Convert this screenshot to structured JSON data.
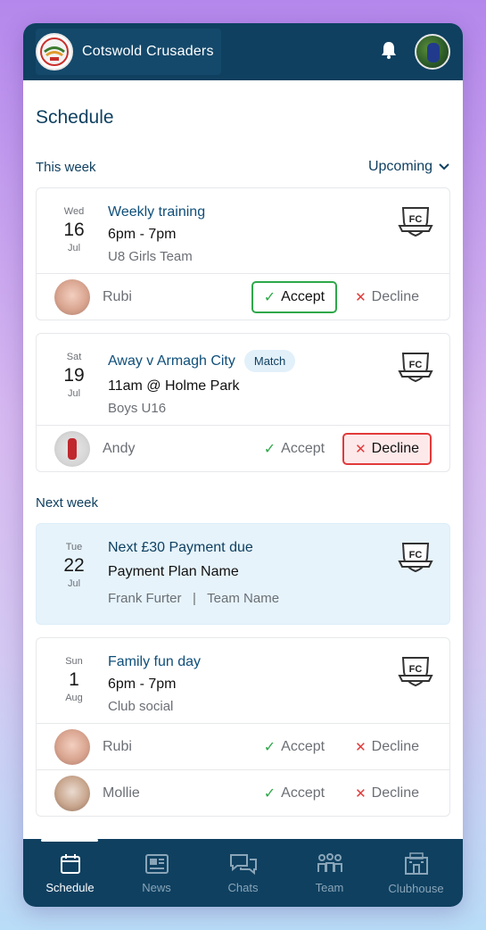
{
  "header": {
    "club_name": "Cotswold Crusaders",
    "bell_icon": "bell-icon",
    "profile_icon": "user-avatar"
  },
  "page": {
    "title": "Schedule"
  },
  "this_week": {
    "title": "This week",
    "filter_label": "Upcoming",
    "events": [
      {
        "dow": "Wed",
        "day": "16",
        "month": "Jul",
        "title": "Weekly training",
        "time": "6pm - 7pm",
        "subtitle": "U8 Girls Team",
        "responses": [
          {
            "name": "Rubi",
            "accept": "Accept",
            "decline": "Decline",
            "status": "accepted"
          }
        ]
      },
      {
        "dow": "Sat",
        "day": "19",
        "month": "Jul",
        "title": "Away v Armagh City",
        "tag": "Match",
        "time": "11am @ Holme Park",
        "subtitle": "Boys U16",
        "responses": [
          {
            "name": "Andy",
            "accept": "Accept",
            "decline": "Decline",
            "status": "declined"
          }
        ]
      }
    ]
  },
  "next_week": {
    "title": "Next week",
    "payment": {
      "dow": "Tue",
      "day": "22",
      "month": "Jul",
      "title": "Next £30 Payment due",
      "plan": "Payment Plan Name",
      "person": "Frank Furter",
      "separator": "|",
      "team": "Team Name"
    },
    "events": [
      {
        "dow": "Sun",
        "day": "1",
        "month": "Aug",
        "title": "Family fun day",
        "time": "6pm - 7pm",
        "subtitle": "Club social",
        "responses": [
          {
            "name": "Rubi",
            "accept": "Accept",
            "decline": "Decline",
            "status": "none"
          },
          {
            "name": "Mollie",
            "accept": "Accept",
            "decline": "Decline",
            "status": "none"
          }
        ]
      }
    ]
  },
  "badge_text": "FC",
  "nav": [
    {
      "label": "Schedule",
      "icon": "calendar-icon",
      "active": true
    },
    {
      "label": "News",
      "icon": "newspaper-icon",
      "active": false
    },
    {
      "label": "Chats",
      "icon": "chat-icon",
      "active": false
    },
    {
      "label": "Team",
      "icon": "team-icon",
      "active": false
    },
    {
      "label": "Clubhouse",
      "icon": "clubhouse-icon",
      "active": false
    }
  ],
  "colors": {
    "primary": "#0f4060",
    "accept": "#2ea84a",
    "decline": "#e23a3a",
    "highlight": "#e6f3fb"
  }
}
